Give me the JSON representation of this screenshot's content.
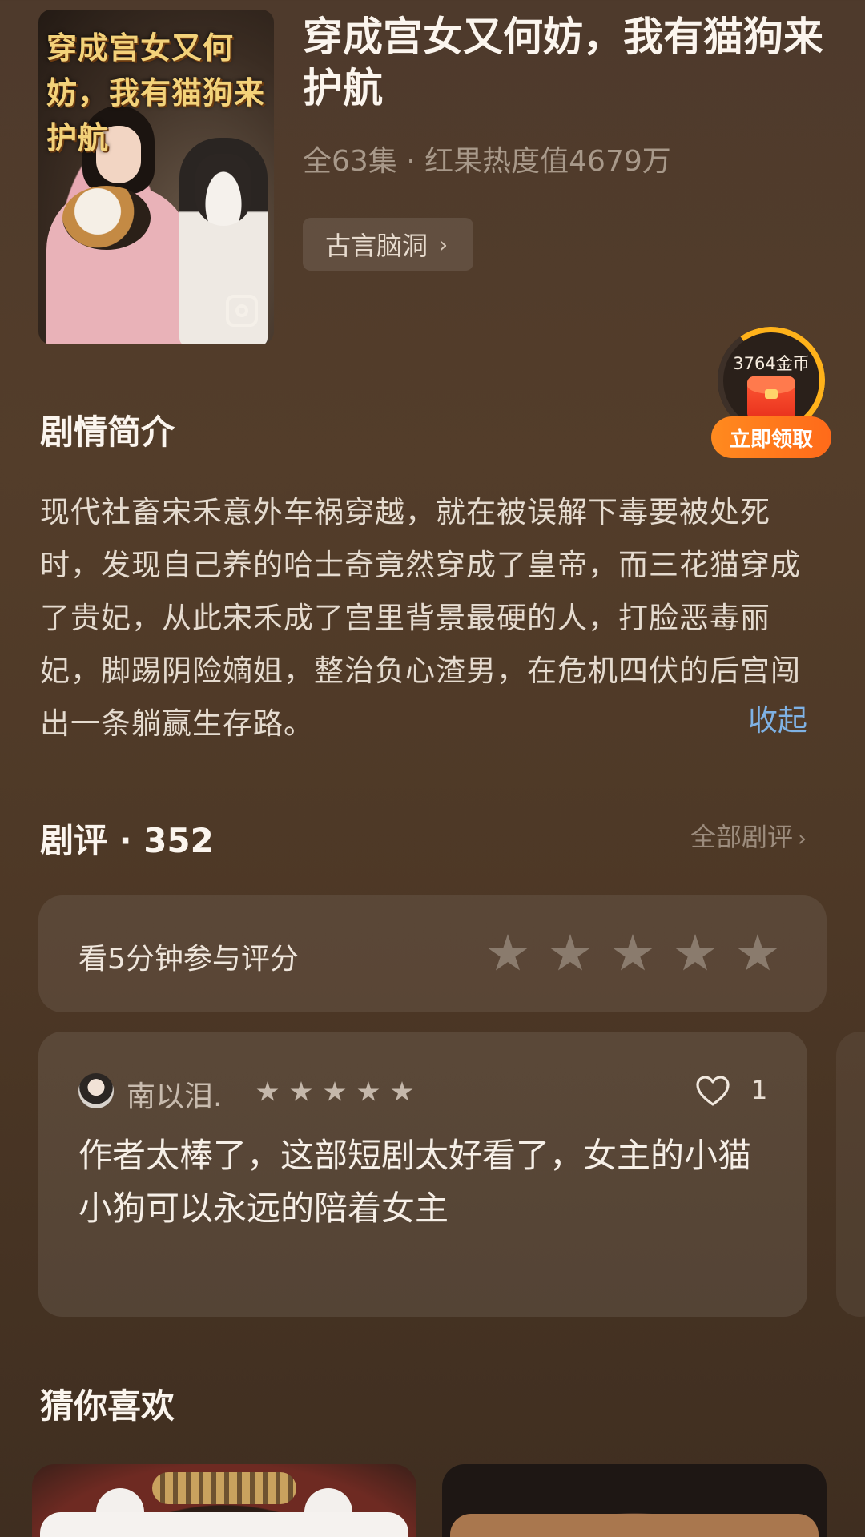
{
  "drama": {
    "poster_title": "穿成宫女又何妨，我有猫狗来护航",
    "title": "穿成宫女又何妨，我有猫狗来护航",
    "meta": "全63集 · 红果热度值4679万",
    "tag": "古言脑洞"
  },
  "coin_widget": {
    "amount": "3764金币",
    "claim_label": "立即领取",
    "progress_color": "#ffb21a"
  },
  "synopsis": {
    "heading": "剧情简介",
    "text": "现代社畜宋禾意外车祸穿越，就在被误解下毒要被处死时，发现自己养的哈士奇竟然穿成了皇帝，而三花猫穿成了贵妃，从此宋禾成了宫里背景最硬的人，打脸恶毒丽妃，脚踢阴险嫡姐，整治负心渣男，在危机四伏的后宫闯出一条躺赢生存路。",
    "collapse_label": "收起"
  },
  "reviews": {
    "heading": "剧评 · 352",
    "all_label": "全部剧评",
    "rate_prompt": "看5分钟参与评分",
    "rate_stars": 5,
    "items": [
      {
        "user": "南以泪.",
        "stars": 5,
        "likes": "1",
        "text": "作者太棒了，这部短剧太好看了，女主的小猫小狗可以永远的陪着女主"
      }
    ]
  },
  "recommend": {
    "heading": "猜你喜欢"
  },
  "colors": {
    "accent_link": "#7fb2e5",
    "claim_button": "#ff7a1f"
  }
}
